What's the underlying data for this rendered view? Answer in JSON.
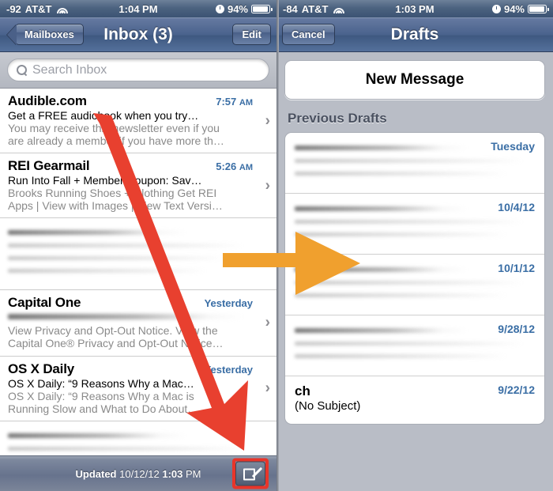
{
  "left": {
    "status": {
      "signal": "-92",
      "carrier": "AT&T",
      "wifi_icon": "wifi-icon",
      "time": "1:04 PM",
      "alarm_icon": "clock-icon",
      "battery_pct": "94%",
      "battery_icon": "battery-icon"
    },
    "nav": {
      "back_label": "Mailboxes",
      "title": "Inbox (3)",
      "edit_label": "Edit"
    },
    "search": {
      "placeholder": "Search Inbox",
      "icon": "search-icon"
    },
    "messages": [
      {
        "from": "Audible.com",
        "time": "7:57",
        "ampm": "AM",
        "subject": "Get a FREE audiobook when you try…",
        "preview1": "You may receive this newsletter even if you",
        "preview2": "are already a member if you have more th…",
        "blurred": false
      },
      {
        "from": "REI Gearmail",
        "time": "5:26",
        "ampm": "AM",
        "subject": "Run Into Fall + Member Coupon: Sav…",
        "preview1": "Brooks Running Shoes + Clothing Get REI",
        "preview2": "Apps | View with Images | View Text Versi…",
        "blurred": false
      },
      {
        "from": "",
        "time": "",
        "ampm": "",
        "subject": "",
        "preview1": "",
        "preview2": "",
        "blurred": true
      },
      {
        "from": "Capital One",
        "time": "Yesterday",
        "ampm": "",
        "subject": "",
        "preview1": "View Privacy and Opt-Out Notice. View the",
        "preview2": "Capital One® Privacy and Opt-Out Notice…",
        "blurred": false
      },
      {
        "from": "OS X Daily",
        "time": "Yesterday",
        "ampm": "",
        "subject": "OS X Daily: “9 Reasons Why a Mac…",
        "preview1": "OS X Daily: “9 Reasons Why a Mac is",
        "preview2": "Running Slow and What to Do About…",
        "blurred": false
      },
      {
        "from": "",
        "time": "",
        "ampm": "",
        "subject": "",
        "preview1": "",
        "preview2": "",
        "blurred": true
      }
    ],
    "toolbar": {
      "updated_label": "Updated",
      "updated_date": "10/12/12",
      "updated_time": "1:03",
      "updated_ampm": "PM",
      "compose_icon": "compose-icon",
      "highlight_color": "#e8352a"
    }
  },
  "right": {
    "status": {
      "signal": "-84",
      "carrier": "AT&T",
      "wifi_icon": "wifi-icon",
      "time": "1:03 PM",
      "alarm_icon": "clock-icon",
      "battery_pct": "94%",
      "battery_icon": "battery-icon"
    },
    "nav": {
      "cancel_label": "Cancel",
      "title": "Drafts"
    },
    "new_message_label": "New Message",
    "group_header": "Previous Drafts",
    "drafts": [
      {
        "date": "Tuesday",
        "from": "",
        "subject": "",
        "blurred": true
      },
      {
        "date": "10/4/12",
        "from": "",
        "subject": "",
        "blurred": true
      },
      {
        "date": "10/1/12",
        "from": "",
        "subject": "",
        "blurred": true
      },
      {
        "date": "9/28/12",
        "from": "",
        "subject": "",
        "blurred": true
      },
      {
        "date": "9/22/12",
        "from": "ch",
        "subject": "(No Subject)",
        "blurred": false
      }
    ]
  },
  "annotations": {
    "red_arrow": {
      "name": "red-arrow",
      "color": "#e8402f"
    },
    "orange_arrow": {
      "name": "orange-arrow",
      "color": "#f0a02e"
    }
  }
}
